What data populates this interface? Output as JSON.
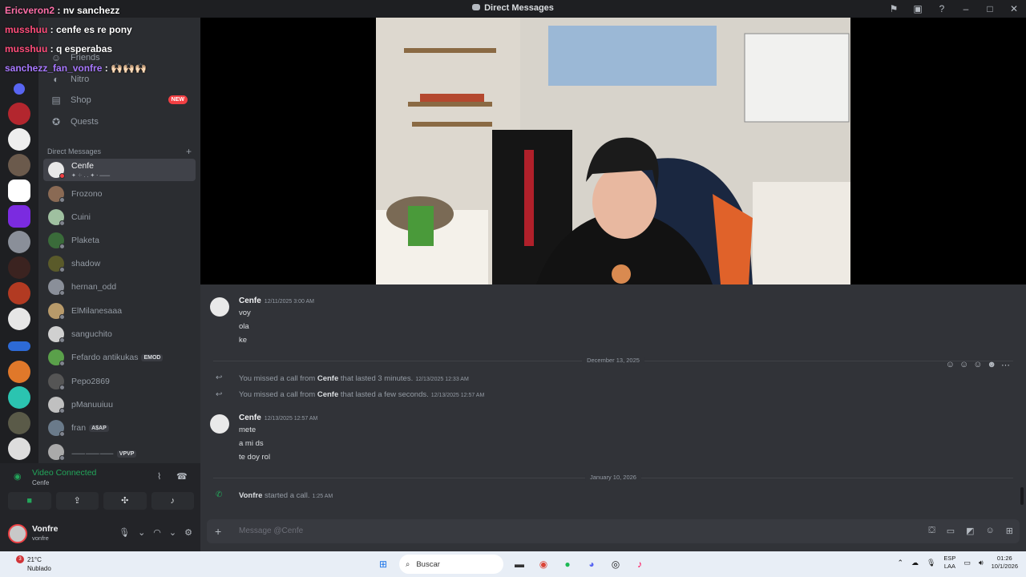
{
  "window": {
    "title": "Direct Messages"
  },
  "overlay_chat": [
    {
      "user": "Ericveron2",
      "text": "nv sanchezz",
      "color": "#ff6fa8"
    },
    {
      "user": "musshuu",
      "text": "cenfe es re pony",
      "color": "#ff4d7a"
    },
    {
      "user": "musshuu",
      "text": "q esperabas",
      "color": "#ff4d7a"
    },
    {
      "user": "sanchezz_fan_vonfre",
      "text": "🙌🏻🙌🏻🙌🏻",
      "color": "#a878ff"
    }
  ],
  "overlay_sep": " : ",
  "nav": {
    "friends": "Friends",
    "nitro": "Nitro",
    "shop": "Shop",
    "shop_badge": "NEW",
    "quests": "Quests"
  },
  "dm_header": "Direct Messages",
  "dms": [
    {
      "name": "Cenfe",
      "active": true,
      "sub": "✦ ⁘ . . ✦ ⸱ ⸺"
    },
    {
      "name": "Frozono"
    },
    {
      "name": "Cuini"
    },
    {
      "name": "Plaketa"
    },
    {
      "name": "shadow"
    },
    {
      "name": "hernan_odd"
    },
    {
      "name": "ElMilanesaaa"
    },
    {
      "name": "sanguchito"
    },
    {
      "name": "Fefardo antikukas",
      "tag": "EMOD"
    },
    {
      "name": "Pepo2869"
    },
    {
      "name": "pManuuiuu"
    },
    {
      "name": "fran",
      "tag": "A$AP"
    },
    {
      "name": "⸺⸺⸺",
      "tag": "VPVP"
    }
  ],
  "voice": {
    "status": "Video Connected",
    "channel": "Cenfe"
  },
  "user": {
    "name": "Vonfre",
    "tag": "vonfre"
  },
  "messages": {
    "group1": {
      "author": "Cenfe",
      "time": "12/11/2025 3:00 AM",
      "lines": [
        "voy",
        "ola",
        "ke"
      ]
    },
    "divider1": "December 13, 2025",
    "missed1": {
      "pre": "You missed a call from ",
      "who": "Cenfe",
      "post": " that lasted 3 minutes.",
      "time": "12/13/2025 12:33 AM"
    },
    "missed2": {
      "pre": "You missed a call from ",
      "who": "Cenfe",
      "post": " that lasted a few seconds.",
      "time": "12/13/2025 12:57 AM"
    },
    "group2": {
      "author": "Cenfe",
      "time": "12/13/2025 12:57 AM",
      "lines": [
        "mete",
        "a mi ds",
        "te doy rol"
      ]
    },
    "divider2": "January 10, 2026",
    "call": {
      "who": "Vonfre",
      "post": " started a call.",
      "time": "1:25 AM"
    }
  },
  "composer": {
    "placeholder": "Message @Cenfe"
  },
  "taskbar": {
    "temp": "21°C",
    "weather": "Nublado",
    "weather_badge": "3",
    "search": "Buscar",
    "lang1": "ESP",
    "lang2": "LAA",
    "time": "01:26",
    "date": "10/1/2026"
  },
  "colors": {
    "green": "#23a55a",
    "red": "#f23f43",
    "blurple": "#5865f2"
  }
}
